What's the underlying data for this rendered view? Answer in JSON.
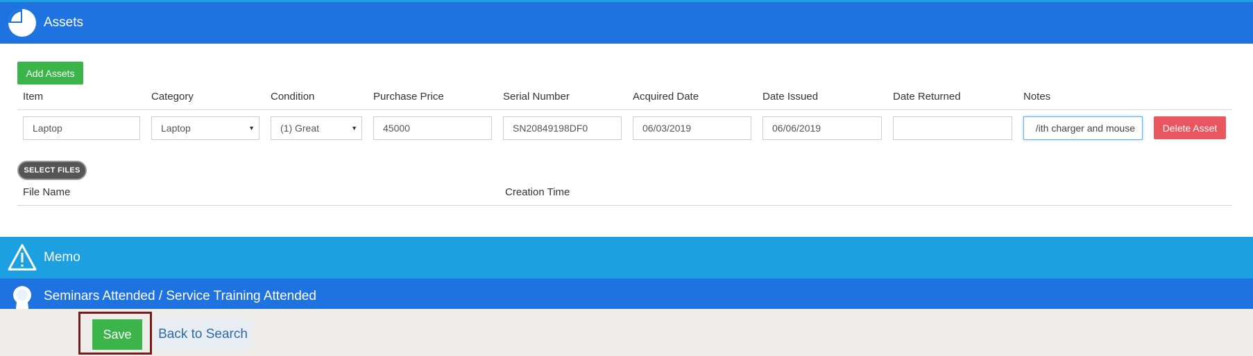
{
  "sections": {
    "assets": {
      "title": "Assets",
      "icon": "pie-chart-icon"
    },
    "memo": {
      "title": "Memo",
      "icon": "warning-icon"
    },
    "seminars": {
      "title": "Seminars Attended / Service Training Attended",
      "icon": "award-ribbon-icon"
    }
  },
  "assets": {
    "add_button": "Add Assets",
    "columns": [
      "Item",
      "Category",
      "Condition",
      "Purchase Price",
      "Serial Number",
      "Acquired Date",
      "Date Issued",
      "Date Returned",
      "Notes"
    ],
    "row": {
      "item": "Laptop",
      "category": "Laptop",
      "condition": "(1) Great",
      "purchase_price": "45000",
      "serial_number": "SN20849198DF0",
      "acquired_date": "06/03/2019",
      "date_issued": "06/06/2019",
      "date_returned": "",
      "notes": "/ith charger and mouse"
    },
    "delete_button": "Delete Asset"
  },
  "files": {
    "select_button": "SELECT FILES",
    "columns": [
      "File Name",
      "Creation Time"
    ]
  },
  "footer": {
    "save_label": "Save",
    "back_label": "Back to Search"
  },
  "colors": {
    "header_blue": "#1f73e0",
    "memo_blue": "#1ca0e0",
    "add_green": "#3bb54a",
    "delete_red": "#e9565f",
    "highlight_border": "#7a1a1a"
  }
}
